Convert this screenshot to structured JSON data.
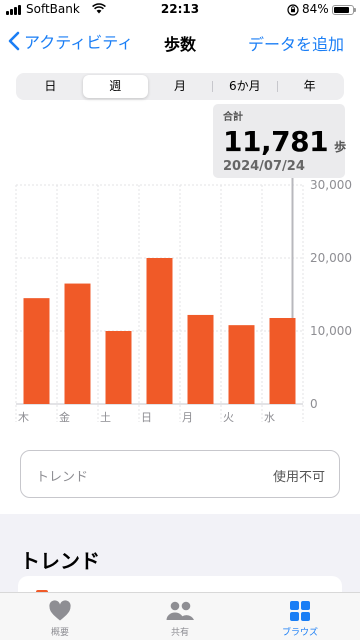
{
  "status_bar": {
    "carrier": "SoftBank",
    "time": "22:13",
    "battery_percent": "84%",
    "battery_level": 0.84,
    "icons": [
      "signal-icon",
      "wifi-icon",
      "orientation-lock-icon",
      "battery-icon"
    ]
  },
  "nav": {
    "back_label": "アクティビティ",
    "title": "歩数",
    "add_label": "データを追加"
  },
  "range_tabs": [
    {
      "label": "日",
      "active": false
    },
    {
      "label": "週",
      "active": true
    },
    {
      "label": "月",
      "active": false
    },
    {
      "label": "6か月",
      "active": false
    },
    {
      "label": "年",
      "active": false
    }
  ],
  "tooltip": {
    "label": "合計",
    "value": "11,781",
    "unit": "歩",
    "date": "2024/07/24"
  },
  "chart_data": {
    "type": "bar",
    "categories": [
      "木",
      "金",
      "土",
      "日",
      "月",
      "火",
      "水"
    ],
    "values": [
      14500,
      16500,
      10000,
      20000,
      12200,
      10800,
      11781
    ],
    "y_ticks": [
      "0",
      "10,000",
      "20,000",
      "30,000"
    ],
    "ylim": [
      0,
      30000
    ],
    "bar_color": "#f05a28",
    "selected_index": 6,
    "grid": true
  },
  "trend_card": {
    "label": "トレンド",
    "value": "使用不可"
  },
  "section_heading": "トレンド",
  "tab_bar": [
    {
      "label": "概要",
      "icon": "heart-icon",
      "active": false
    },
    {
      "label": "共有",
      "icon": "people-icon",
      "active": false
    },
    {
      "label": "ブラウズ",
      "icon": "grid-icon",
      "active": true
    }
  ],
  "colors": {
    "accent": "#1a7ef5",
    "bar": "#f05a28"
  }
}
